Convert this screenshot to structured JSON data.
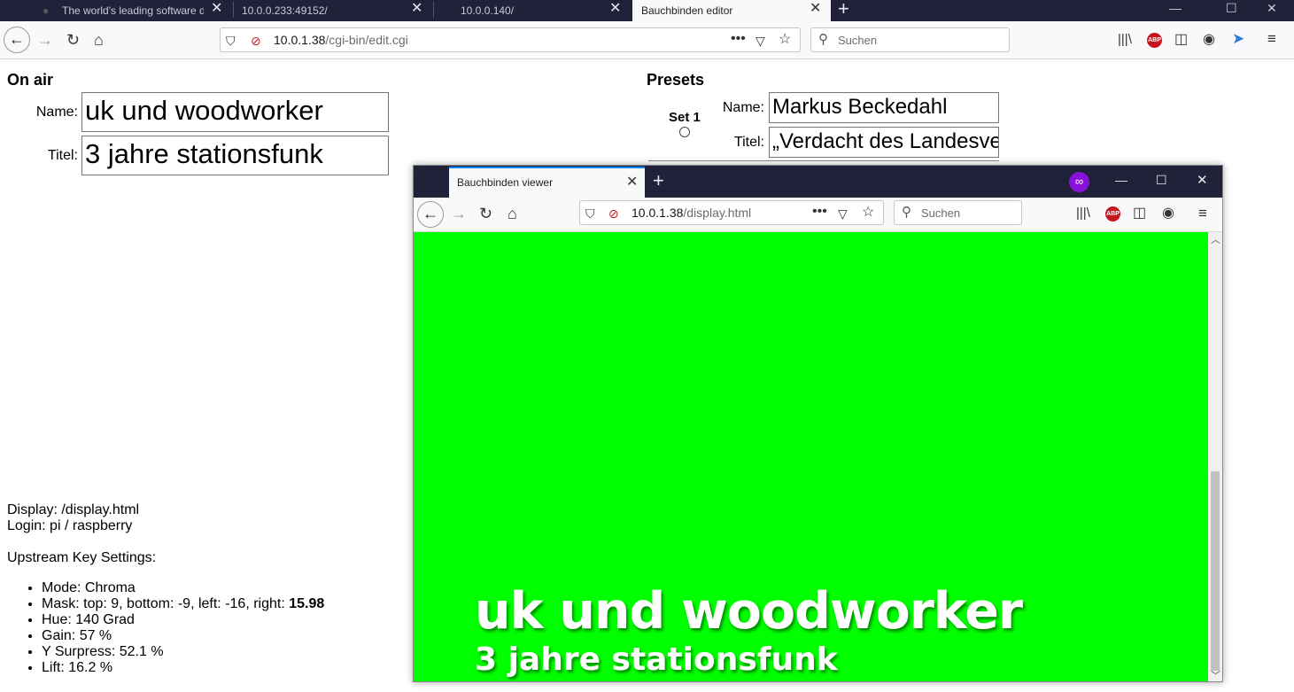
{
  "browser": {
    "tabs": [
      {
        "label": "The world's leading software de",
        "active": false
      },
      {
        "label": "10.0.0.233:49152/",
        "active": false
      },
      {
        "label": "10.0.0.140/",
        "active": false
      },
      {
        "label": "Bauchbinden editor",
        "active": true
      }
    ],
    "url_host": "10.0.1.38",
    "url_path": "/cgi-bin/edit.cgi",
    "search_placeholder": "Suchen"
  },
  "on_air": {
    "heading": "On air",
    "name_label": "Name:",
    "name_value": "uk und woodworker",
    "title_label": "Titel:",
    "title_value": "3 jahre stationsfunk"
  },
  "presets": {
    "heading": "Presets",
    "set_label": "Set 1",
    "name_label": "Name:",
    "name_value": "Markus Beckedahl",
    "title_label": "Titel:",
    "title_value": "„Verdacht des Landesve"
  },
  "info": {
    "display": "Display: /display.html",
    "login": "Login: pi / raspberry",
    "upstream_heading": "Upstream Key Settings:",
    "mode": "Mode: Chroma",
    "mask_prefix": "Mask: top: 9, bottom: -9, left: -16, right: ",
    "mask_bold": "15.98",
    "hue": "Hue: 140 Grad",
    "gain": "Gain: 57 %",
    "y_surpress": "Y Surpress: 52.1 %",
    "lift": "Lift: 16.2 %"
  },
  "viewer": {
    "tab_label": "Bauchbinden viewer",
    "url_host": "10.0.1.38",
    "url_path": "/display.html",
    "search_placeholder": "Suchen",
    "overlay_name": "uk und woodworker",
    "overlay_title": "3 jahre stationsfunk",
    "background_color": "#00ff00"
  }
}
